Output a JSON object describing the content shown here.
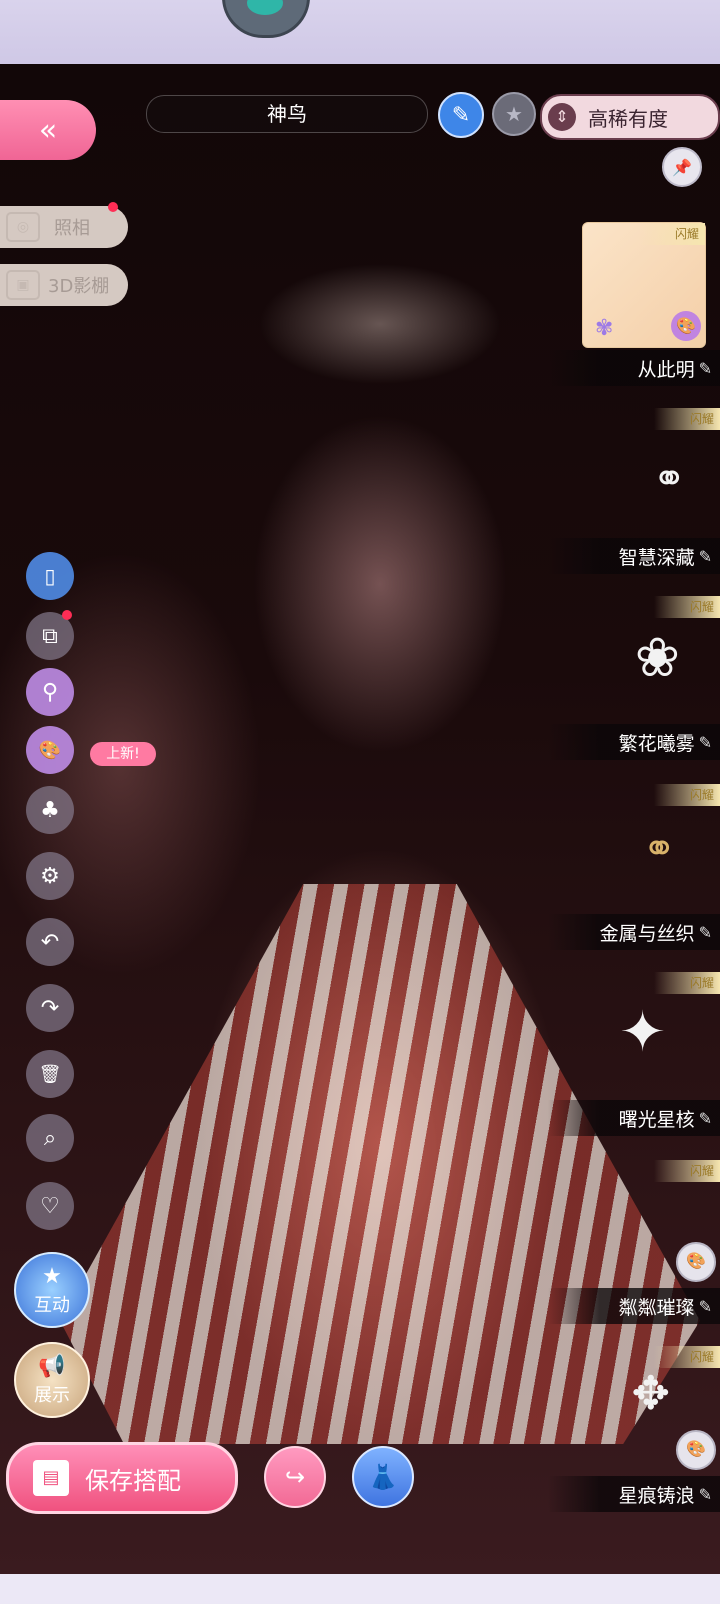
{
  "header": {
    "outfit_name": "神鸟",
    "rarity_sort_label": "高稀有度"
  },
  "left_menu": {
    "back_icon": "«",
    "photo_label": "照相",
    "studio3d_label": "3D影棚",
    "new_tag": "上新!",
    "interact_label": "互动",
    "display_label": "展示"
  },
  "bottom": {
    "save_label": "保存搭配"
  },
  "items": [
    {
      "name": "从此明",
      "badge": "闪耀"
    },
    {
      "name": "智慧深藏",
      "badge": "闪耀"
    },
    {
      "name": "繁花曦雾",
      "badge": "闪耀"
    },
    {
      "name": "金属与丝织",
      "badge": "闪耀"
    },
    {
      "name": "曙光星核",
      "badge": "闪耀"
    },
    {
      "name": "粼粼璀璨",
      "badge": "闪耀"
    },
    {
      "name": "星痕铸浪",
      "badge": "闪耀"
    }
  ],
  "icons": {
    "edit": "✎",
    "pencil": "✎",
    "star": "★",
    "sort": "⇕",
    "pin": "📌",
    "camera": "◎",
    "cube": "▣",
    "palette": "🎨",
    "undo": "↶",
    "redo": "↷",
    "trash": "🗑",
    "search": "⌕",
    "heart": "♡",
    "gear": "⚙"
  },
  "colors": {
    "accent_pink": "#f06595",
    "accent_blue": "#3e86e8",
    "rarity_border": "#6a3d4d"
  }
}
